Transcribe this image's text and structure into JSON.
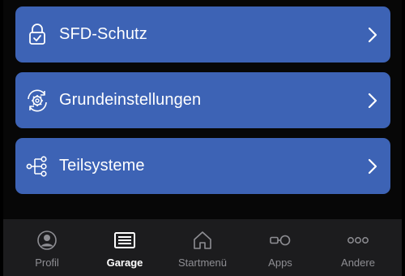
{
  "colors": {
    "row_background": "#3d63b5",
    "tab_inactive": "#8e8e93",
    "tab_active": "#ffffff"
  },
  "menu": {
    "items": [
      {
        "label": "SFD-Schutz",
        "icon": "lock-icon"
      },
      {
        "label": "Grundeinstellungen",
        "icon": "settings-cycle-icon"
      },
      {
        "label": "Teilsysteme",
        "icon": "tree-icon"
      }
    ]
  },
  "tabbar": {
    "active": "Garage",
    "tabs": [
      {
        "label": "Profil",
        "icon": "profile-icon"
      },
      {
        "label": "Garage",
        "icon": "garage-icon"
      },
      {
        "label": "Startmenü",
        "icon": "home-icon"
      },
      {
        "label": "Apps",
        "icon": "apps-icon"
      },
      {
        "label": "Andere",
        "icon": "more-icon"
      }
    ]
  }
}
